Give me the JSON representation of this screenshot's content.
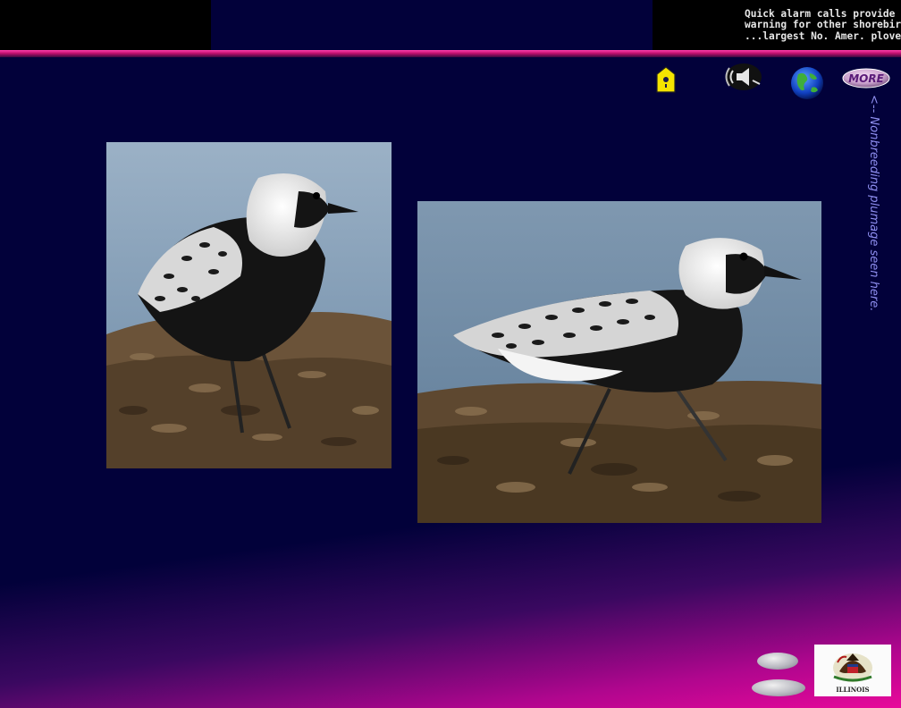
{
  "caption": {
    "line1": "Quick alarm calls provide",
    "line2": "warning for other shorebirds",
    "line3": "...largest No. Amer. plover."
  },
  "side_note": "<-- Nonbreeding plumage seen here.",
  "toolbar": {
    "more_label": "MORE",
    "icons": [
      "birdhouse-icon",
      "sound-speaker-icon",
      "globe-icon",
      "more-button"
    ]
  },
  "photos": [
    "plover-standing-photo",
    "plover-walking-photo"
  ],
  "flag": {
    "label": "ILLINOIS"
  },
  "colors": {
    "background": "#02013a",
    "accent": "#e8089a",
    "topbar": "#000000"
  }
}
